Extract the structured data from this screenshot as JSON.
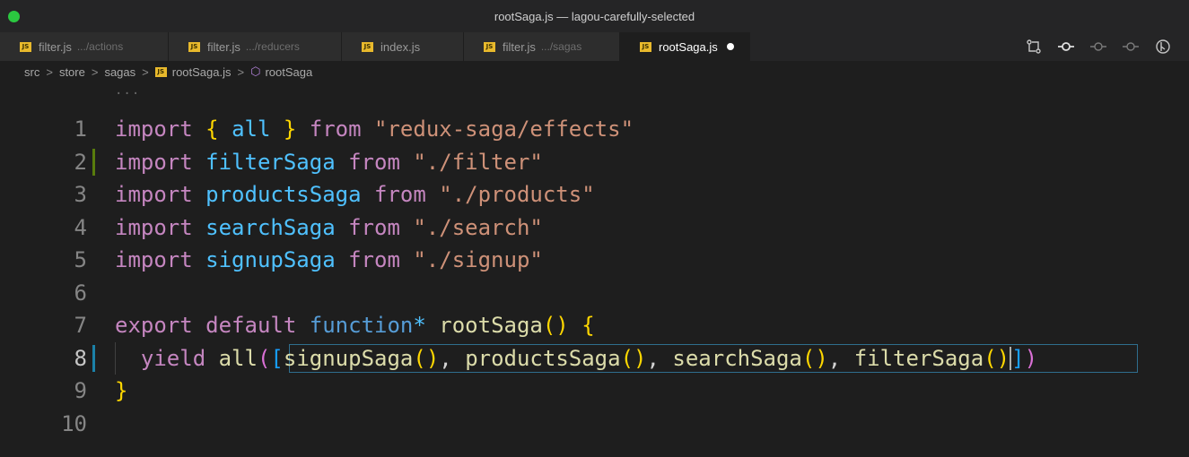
{
  "window": {
    "title": "rootSaga.js — lagou-carefully-selected"
  },
  "tabs": [
    {
      "label": "filter.js",
      "hint": ".../actions",
      "active": false,
      "width": 188
    },
    {
      "label": "filter.js",
      "hint": ".../reducers",
      "active": false,
      "width": 193
    },
    {
      "label": "index.js",
      "hint": "",
      "active": false,
      "width": 136
    },
    {
      "label": "filter.js",
      "hint": ".../sagas",
      "active": false,
      "width": 174
    },
    {
      "label": "rootSaga.js",
      "hint": "",
      "active": true,
      "modified": true,
      "width": 145
    }
  ],
  "file_icon_text": "JS",
  "tab_actions": [
    "compare-changes-icon",
    "git-commit-icon",
    "git-previous-icon",
    "git-next-icon",
    "timeline-icon"
  ],
  "breadcrumb": {
    "items": [
      "src",
      "store",
      "sagas",
      "rootSaga.js",
      "rootSaga"
    ],
    "separator": ">"
  },
  "sticky_ellipsis": "...",
  "editor": {
    "line_numbers": [
      "1",
      "2",
      "3",
      "4",
      "5",
      "6",
      "7",
      "8",
      "9",
      "10"
    ],
    "current_line": "8",
    "lines": [
      [
        [
          "kw-ctl",
          "import"
        ],
        [
          "plain",
          " "
        ],
        [
          "brace",
          "{"
        ],
        [
          "plain",
          " "
        ],
        [
          "var",
          "all"
        ],
        [
          "plain",
          " "
        ],
        [
          "brace",
          "}"
        ],
        [
          "plain",
          " "
        ],
        [
          "kw-ctl",
          "from"
        ],
        [
          "plain",
          " "
        ],
        [
          "str",
          "\"redux-saga/effects\""
        ]
      ],
      [
        [
          "kw-ctl",
          "import"
        ],
        [
          "plain",
          " "
        ],
        [
          "var",
          "filterSaga"
        ],
        [
          "plain",
          " "
        ],
        [
          "kw-ctl",
          "from"
        ],
        [
          "plain",
          " "
        ],
        [
          "str",
          "\"./filter\""
        ]
      ],
      [
        [
          "kw-ctl",
          "import"
        ],
        [
          "plain",
          " "
        ],
        [
          "var",
          "productsSaga"
        ],
        [
          "plain",
          " "
        ],
        [
          "kw-ctl",
          "from"
        ],
        [
          "plain",
          " "
        ],
        [
          "str",
          "\"./products\""
        ]
      ],
      [
        [
          "kw-ctl",
          "import"
        ],
        [
          "plain",
          " "
        ],
        [
          "var",
          "searchSaga"
        ],
        [
          "plain",
          " "
        ],
        [
          "kw-ctl",
          "from"
        ],
        [
          "plain",
          " "
        ],
        [
          "str",
          "\"./search\""
        ]
      ],
      [
        [
          "kw-ctl",
          "import"
        ],
        [
          "plain",
          " "
        ],
        [
          "var",
          "signupSaga"
        ],
        [
          "plain",
          " "
        ],
        [
          "kw-ctl",
          "from"
        ],
        [
          "plain",
          " "
        ],
        [
          "str",
          "\"./signup\""
        ]
      ],
      [],
      [
        [
          "kw-ctl",
          "export"
        ],
        [
          "plain",
          " "
        ],
        [
          "kw-ctl",
          "default"
        ],
        [
          "plain",
          " "
        ],
        [
          "kw",
          "function"
        ],
        [
          "var",
          "*"
        ],
        [
          "plain",
          " "
        ],
        [
          "fn",
          "rootSaga"
        ],
        [
          "brace",
          "()"
        ],
        [
          "plain",
          " "
        ],
        [
          "brace",
          "{"
        ]
      ],
      [
        [
          "plain",
          "  "
        ],
        [
          "kw-ctl",
          "yield"
        ],
        [
          "plain",
          " "
        ],
        [
          "fn",
          "all"
        ],
        [
          "brk2",
          "("
        ],
        [
          "brk3",
          "["
        ],
        [
          "fn",
          "signupSaga"
        ],
        [
          "brace",
          "()"
        ],
        [
          "plain",
          ", "
        ],
        [
          "fn",
          "productsSaga"
        ],
        [
          "brace",
          "()"
        ],
        [
          "plain",
          ", "
        ],
        [
          "fn",
          "searchSaga"
        ],
        [
          "brace",
          "()"
        ],
        [
          "plain",
          ", "
        ],
        [
          "fn",
          "filterSaga"
        ],
        [
          "brace",
          "()"
        ],
        [
          "cursor",
          ""
        ],
        [
          "brk3",
          "]"
        ],
        [
          "brk2",
          ")"
        ]
      ],
      [
        [
          "brace",
          "}"
        ]
      ],
      []
    ]
  },
  "colors": {
    "background": "#1e1e1e",
    "keyword_control": "#c586c0",
    "keyword": "#569cd6",
    "variable": "#4fc1ff",
    "string": "#ce9178",
    "function": "#dcdcaa",
    "bracket": "#ffd700",
    "modified_gutter": "#587c0c",
    "current_gutter": "#1b81a8"
  }
}
